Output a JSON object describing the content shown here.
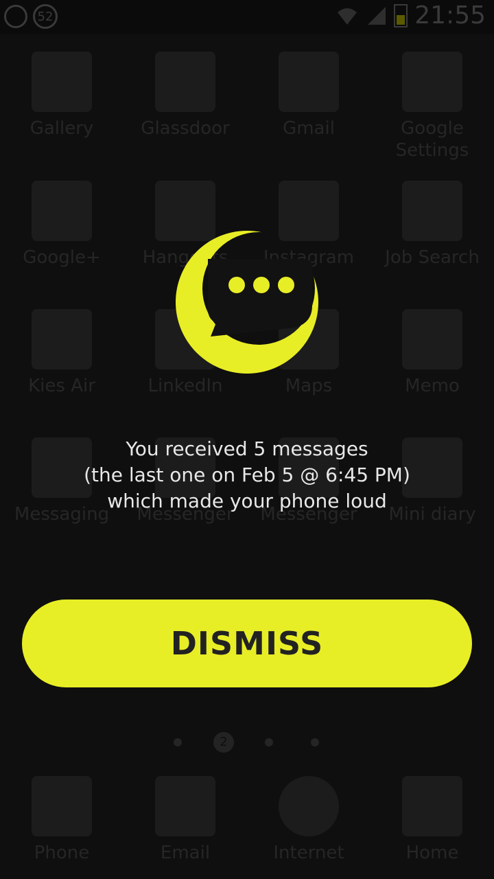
{
  "status_bar": {
    "notification_count": "52",
    "time": "21:55"
  },
  "launcher": {
    "apps": [
      {
        "label": "Gallery",
        "icon": "gallery-icon"
      },
      {
        "label": "Glassdoor",
        "icon": "glassdoor-icon"
      },
      {
        "label": "Gmail",
        "icon": "gmail-icon"
      },
      {
        "label": "Google Settings",
        "icon": "google-settings-icon"
      },
      {
        "label": "Google+",
        "icon": "google-plus-icon"
      },
      {
        "label": "Hangouts",
        "icon": "hangouts-icon"
      },
      {
        "label": "Instagram",
        "icon": "instagram-icon"
      },
      {
        "label": "Job Search",
        "icon": "job-search-icon"
      },
      {
        "label": "Kies Air",
        "icon": "kies-air-icon"
      },
      {
        "label": "LinkedIn",
        "icon": "linkedin-icon"
      },
      {
        "label": "Maps",
        "icon": "maps-icon"
      },
      {
        "label": "Memo",
        "icon": "memo-icon"
      },
      {
        "label": "Messaging",
        "icon": "messaging-icon"
      },
      {
        "label": "Messenger",
        "icon": "messenger-icon"
      },
      {
        "label": "Messenger",
        "icon": "messenger-icon"
      },
      {
        "label": "Mini diary",
        "icon": "mini-diary-icon"
      }
    ],
    "dock": [
      {
        "label": "Phone",
        "icon": "phone-icon"
      },
      {
        "label": "Email",
        "icon": "email-icon"
      },
      {
        "label": "Internet",
        "icon": "internet-icon"
      },
      {
        "label": "Home",
        "icon": "home-icon"
      }
    ],
    "page_indicator": "2"
  },
  "dialog": {
    "logo_icon": "moon-chat-icon",
    "message_lines": [
      "You received 5 messages",
      "(the last one on Feb 5 @ 6:45 PM)",
      "which made your phone loud"
    ],
    "dismiss_label": "DISMISS",
    "accent_color": "#e8ee26"
  }
}
